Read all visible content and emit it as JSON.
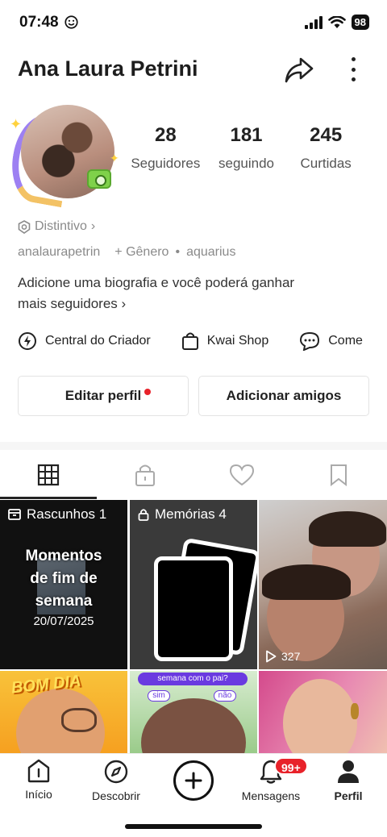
{
  "status_bar": {
    "time": "07:48",
    "battery": "98"
  },
  "header": {
    "title": "Ana Laura Petrini"
  },
  "stats": [
    {
      "value": "28",
      "label": "Seguidores"
    },
    {
      "value": "181",
      "label": "seguindo"
    },
    {
      "value": "245",
      "label": "Curtidas"
    }
  ],
  "badge": {
    "label": "Distintivo",
    "chevron": "›"
  },
  "meta": {
    "username": "analaurapetrin",
    "gender": "+ Gênero",
    "dot": "•",
    "sign": "aquarius"
  },
  "bio": {
    "line1": "Adicione uma biografia e você poderá ganhar",
    "line2": "mais seguidores",
    "chevron": "›"
  },
  "shortcuts": [
    {
      "label": "Central do Criador",
      "icon": "lightning-icon"
    },
    {
      "label": "Kwai Shop",
      "icon": "shopping-bag-icon"
    },
    {
      "label": "Come",
      "icon": "chat-bubble-icon"
    }
  ],
  "actions": {
    "edit_label": "Editar perfil",
    "add_friends_label": "Adicionar amigos"
  },
  "tabs": [
    {
      "icon": "grid-icon",
      "active": true
    },
    {
      "icon": "lock-icon",
      "active": false
    },
    {
      "icon": "heart-icon",
      "active": false
    },
    {
      "icon": "bookmark-icon",
      "active": false
    }
  ],
  "grid": {
    "drafts": {
      "label": "Rascunhos 1",
      "title_lines": [
        "Momentos",
        "de fim de",
        "semana"
      ],
      "date": "20/07/2025"
    },
    "memories": {
      "label": "Memórias 4"
    },
    "video": {
      "views": "327"
    },
    "bom_dia": {
      "text": "BOM DIA"
    },
    "quiz": {
      "question": "semana com o pai?",
      "yes": "sim",
      "no": "não"
    }
  },
  "bottom_nav": {
    "home": "Início",
    "discover": "Descobrir",
    "messages": "Mensagens",
    "messages_badge": "99+",
    "profile": "Perfil"
  },
  "colors": {
    "accent_red": "#e8222a",
    "text_primary": "#222222",
    "text_secondary": "#8a8a8a"
  }
}
